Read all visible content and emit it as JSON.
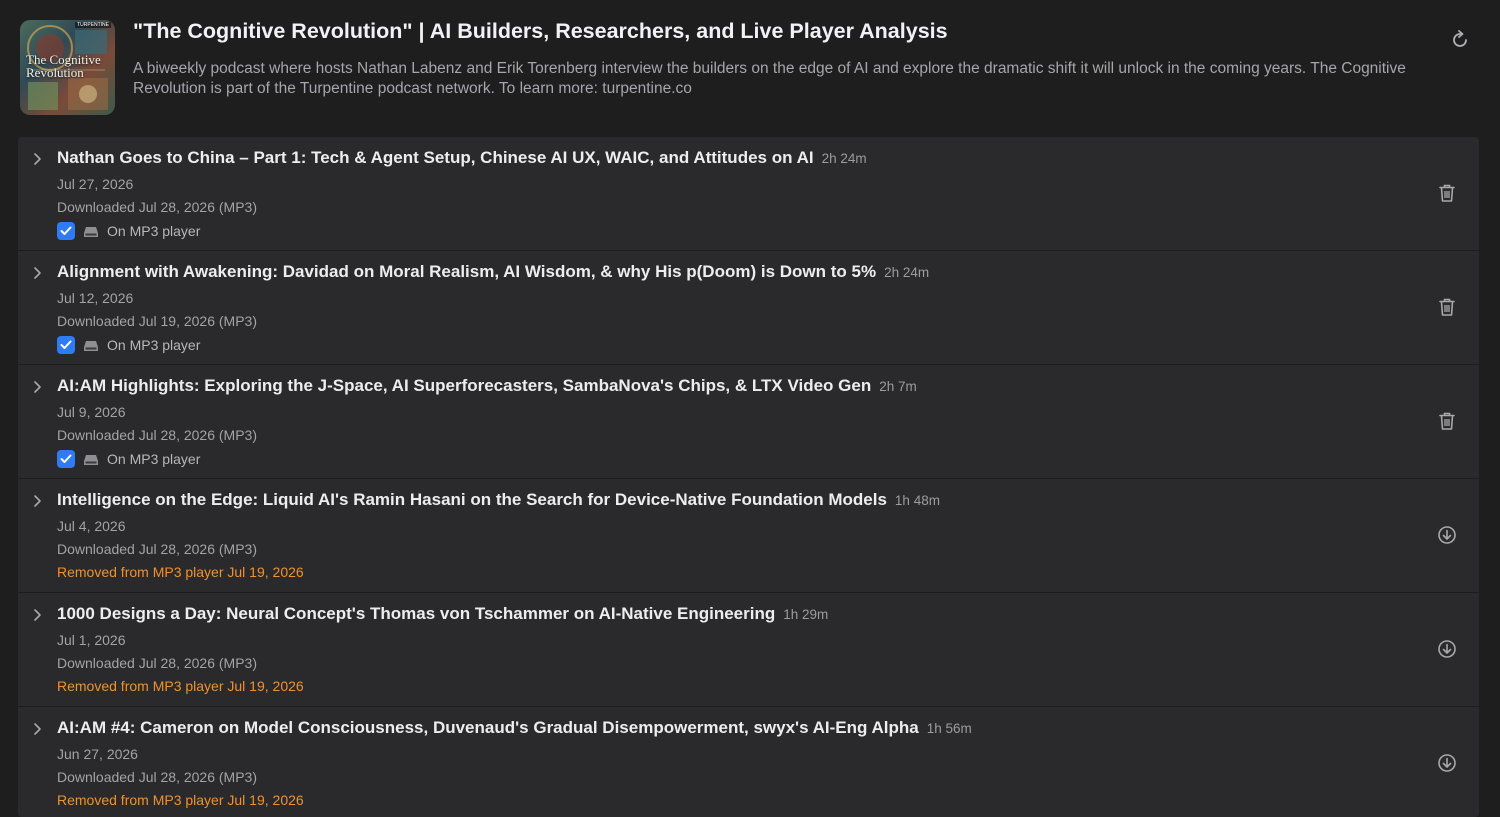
{
  "podcast": {
    "title": "\"The Cognitive Revolution\" | AI Builders, Researchers, and Live Player Analysis",
    "description": "A biweekly podcast where hosts Nathan Labenz and Erik Torenberg interview the builders on the edge of AI and explore the dramatic shift it will unlock in the coming years. The Cognitive Revolution is part of the Turpentine podcast network. To learn more: turpentine.co",
    "artwork_title": "The Cognitive Revolution",
    "artwork_tag": "TURPENTINE"
  },
  "icons": {
    "refresh": "refresh-icon",
    "expand": "chevron-right-icon",
    "delete": "trash-icon",
    "download": "download-icon",
    "device": "drive-icon",
    "check": "checkmark-icon"
  },
  "colors": {
    "background": "#1e1e1f",
    "list_background": "#2a2a2c",
    "accent": "#2f7bf6",
    "removed": "#f0922b"
  },
  "episodes": [
    {
      "title": "Nathan Goes to China – Part 1: Tech & Agent Setup, Chinese AI UX, WAIC, and Attitudes on AI",
      "duration": "2h 24m",
      "date": "Jul 27, 2026",
      "downloaded": "Downloaded Jul 28, 2026 (MP3)",
      "on_player": true,
      "status": "On MP3 player",
      "action": "delete"
    },
    {
      "title": "Alignment with Awakening: Davidad on Moral Realism, AI Wisdom, & why His p(Doom) is Down to 5%",
      "duration": "2h 24m",
      "date": "Jul 12, 2026",
      "downloaded": "Downloaded Jul 19, 2026 (MP3)",
      "on_player": true,
      "status": "On MP3 player",
      "action": "delete"
    },
    {
      "title": "AI:AM Highlights: Exploring the J-Space, AI Superforecasters, SambaNova's Chips, & LTX Video Gen",
      "duration": "2h 7m",
      "date": "Jul 9, 2026",
      "downloaded": "Downloaded Jul 28, 2026 (MP3)",
      "on_player": true,
      "status": "On MP3 player",
      "action": "delete"
    },
    {
      "title": "Intelligence on the Edge: Liquid AI's Ramin Hasani on the Search for Device-Native Foundation Models",
      "duration": "1h 48m",
      "date": "Jul 4, 2026",
      "downloaded": "Downloaded Jul 28, 2026 (MP3)",
      "on_player": false,
      "status": "Removed from MP3 player Jul 19, 2026",
      "action": "download"
    },
    {
      "title": "1000 Designs a Day: Neural Concept's Thomas von Tschammer on AI-Native Engineering",
      "duration": "1h 29m",
      "date": "Jul 1, 2026",
      "downloaded": "Downloaded Jul 28, 2026 (MP3)",
      "on_player": false,
      "status": "Removed from MP3 player Jul 19, 2026",
      "action": "download"
    },
    {
      "title": "AI:AM #4: Cameron on Model Consciousness, Duvenaud's Gradual Disempowerment, swyx's AI-Eng Alpha",
      "duration": "1h 56m",
      "date": "Jun 27, 2026",
      "downloaded": "Downloaded Jul 28, 2026 (MP3)",
      "on_player": false,
      "status": "Removed from MP3 player Jul 19, 2026",
      "action": "download"
    }
  ]
}
